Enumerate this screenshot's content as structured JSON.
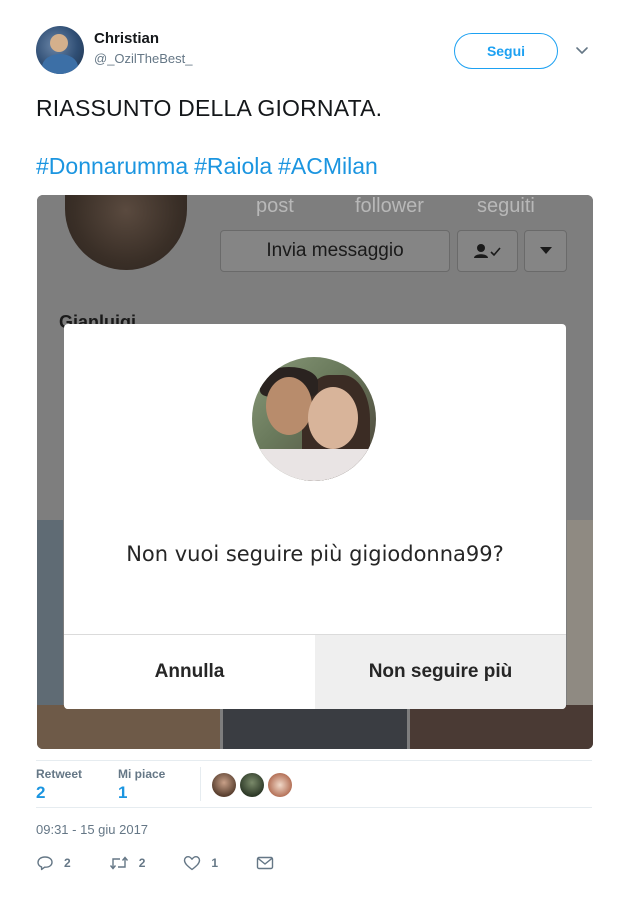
{
  "author": {
    "name": "Christian",
    "handle": "@_OzilTheBest_",
    "avatar_icon": "profile-photo"
  },
  "follow_button": {
    "label": "Segui"
  },
  "menu": {
    "icon": "chevron-down-icon"
  },
  "tweet": {
    "text": "RIASSUNTO DELLA GIORNATA.",
    "hashtags": [
      "#Donnarumma",
      "#Raiola",
      "#ACMilan"
    ]
  },
  "screenshot": {
    "profile_stats": [
      "post",
      "follower",
      "seguiti"
    ],
    "message_button": "Invia messaggio",
    "following_icon": "person-check-icon",
    "dropdown_icon": "caret-down-icon",
    "profile_name": "Gianluigi",
    "dialog": {
      "question": "Non vuoi seguire più gigiodonna99?",
      "cancel_label": "Annulla",
      "unfollow_label": "Non seguire più"
    }
  },
  "stats": {
    "retweet_label": "Retweet",
    "retweet_count": "2",
    "likes_label": "Mi piace",
    "likes_count": "1"
  },
  "timestamp": "09:31 - 15 giu 2017",
  "actions": {
    "reply_count": "2",
    "retweet_count": "2",
    "like_count": "1"
  },
  "colors": {
    "accent": "#1da1f2",
    "hashtag": "#1b95e0",
    "secondary_text": "#657786"
  }
}
